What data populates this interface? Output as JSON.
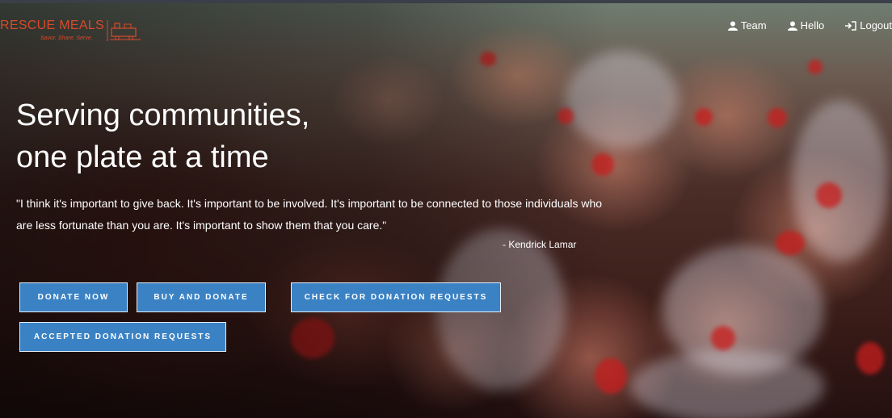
{
  "brand": {
    "name": "RESCUE MEALS",
    "tagline": "Savor. Share. Serve."
  },
  "nav": {
    "items": [
      {
        "label": "Team",
        "icon": "user-icon"
      },
      {
        "label": "Hello",
        "icon": "user-icon"
      },
      {
        "label": "Logout",
        "icon": "logout-icon"
      }
    ]
  },
  "hero": {
    "headline_line1": "Serving communities,",
    "headline_line2": "one plate at a time",
    "quote": "\"I think it's important to give back. It's important to be involved. It's important to be connected to those individuals who are less fortunate than you are. It's important to show them that you care.\"",
    "attribution": "- Kendrick Lamar"
  },
  "buttons": {
    "donate_now": "DONATE NOW",
    "buy_and_donate": "BUY AND DONATE",
    "check_requests": "CHECK FOR DONATION REQUESTS",
    "accepted_requests": "ACCEPTED DONATION REQUESTS"
  },
  "colors": {
    "brand": "#d94a2a",
    "button": "#3b82c4",
    "button_border": "#e6eef6",
    "text": "#ffffff"
  }
}
